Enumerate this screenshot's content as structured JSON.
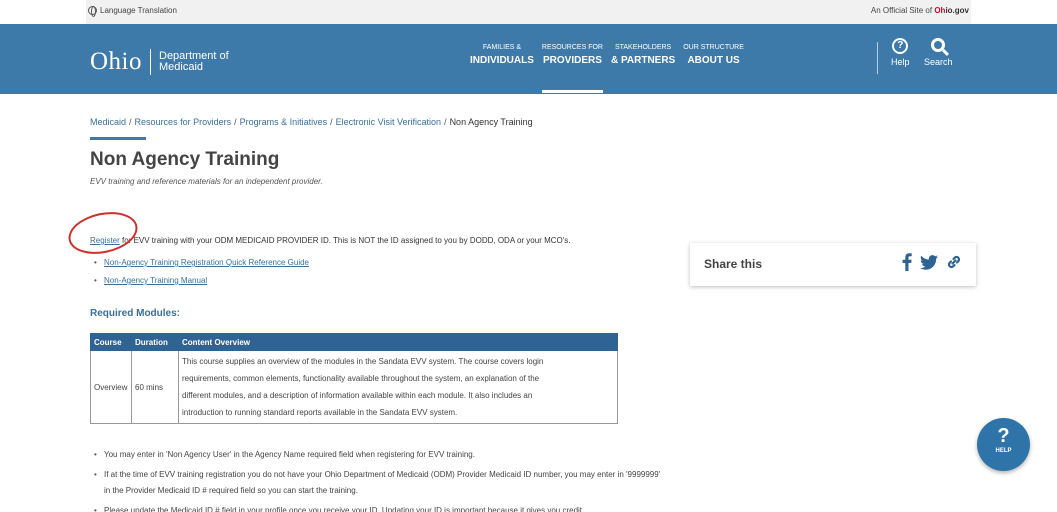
{
  "topbar": {
    "language": "Language Translation",
    "official_prefix": "An Official Site of",
    "official_oh": "Oh",
    "official_io": "io",
    "official_gov": ".gov"
  },
  "header": {
    "logo_word": "Ohio",
    "dept_line1": "Department of",
    "dept_line2": "Medicaid",
    "nav": [
      {
        "small": "FAMILIES &",
        "big": "INDIVIDUALS"
      },
      {
        "small": "RESOURCES FOR",
        "big": "PROVIDERS"
      },
      {
        "small": "STAKEHOLDERS",
        "big": "& PARTNERS"
      },
      {
        "small": "OUR STRUCTURE",
        "big": "ABOUT US"
      }
    ],
    "help_label": "Help",
    "search_label": "Search",
    "help_glyph": "?"
  },
  "breadcrumb": {
    "items": [
      "Medicaid",
      "Resources for Providers",
      "Programs & Initiatives",
      "Electronic Visit Verification"
    ],
    "current": "Non Agency Training",
    "separator": "/"
  },
  "page": {
    "title": "Non Agency Training",
    "subtitle": "EVV training and reference materials for an independent provider.",
    "register_link": "Register",
    "intro_rest": " for EVV training with your ODM MEDICAID PROVIDER ID. This is NOT the ID assigned to you by DODD, ODA or your  MCO's.",
    "links": [
      "Non-Agency Training Registration Quick Reference Guide",
      "Non-Agency Training Manual"
    ],
    "modules_heading": "Required Modules:"
  },
  "table": {
    "headers": [
      "Course",
      "Duration",
      "Content Overview"
    ],
    "row": {
      "course": "Overview",
      "duration": "60 mins",
      "lines": [
        "This course supplies an overview of the modules in the Sandata EVV system. The course covers login",
        "requirements, common elements, functionality available throughout the system, an explanation of the",
        "different modules, and a description of information available within each module. It also includes an",
        "introduction to running standard reports available in the Sandata EVV system."
      ]
    }
  },
  "notes": [
    "You may enter in 'Non Agency User' in the Agency Name required field when registering for EVV training.",
    "If at the time of EVV training registration you do not have your Ohio Department of Medicaid (ODM) Provider Medicaid ID number, you may enter in '9999999' in the Provider Medicaid ID # required field so you can start the training.",
    "Please update the Medicaid ID # field in your profile once you receive your ID. Updating your ID is important because it gives you credit"
  ],
  "share": {
    "label": "Share this",
    "icons": [
      "facebook-icon",
      "twitter-icon",
      "link-icon"
    ]
  },
  "help_fab": {
    "glyph": "?",
    "label": "HELP"
  },
  "colors": {
    "header_blue": "#3d7aaa",
    "table_header": "#2f6393",
    "link": "#3a6f99",
    "annotation_red": "#d0302b"
  }
}
